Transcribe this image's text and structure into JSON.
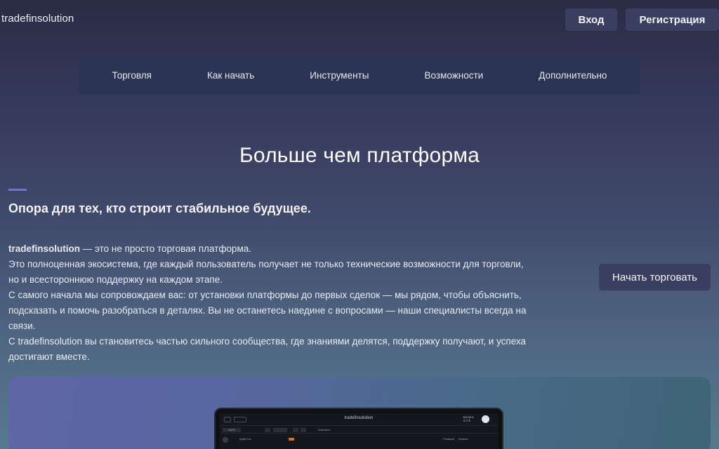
{
  "header": {
    "brand": "tradefinsolution",
    "login_label": "Вход",
    "register_label": "Регистрация"
  },
  "nav": {
    "items": [
      {
        "label": "Торговля"
      },
      {
        "label": "Как начать"
      },
      {
        "label": "Инструменты"
      },
      {
        "label": "Возможности"
      },
      {
        "label": "Дополнительно"
      }
    ]
  },
  "hero": {
    "title": "Больше чем платформа",
    "subtitle": "Опора для тех, кто строит стабильное будущее.",
    "lead_brand": "tradefinsolution",
    "lead_rest": " — это не просто торговая платформа.",
    "paragraph2": "Это полноценная экосистема, где каждый пользователь получает не только технические возможности для торговли, но и всестороннюю поддержку на каждом этапе.",
    "paragraph3": "С самого начала мы сопровождаем вас: от установки платформы до первых сделок — мы рядом, чтобы объяснить, подсказать и помочь разобраться в деталях. Вы не останетесь наедине с вопросами — наши специалисты всегда на связи.",
    "paragraph4": "С tradefinsolution вы становитесь частью сильного сообщества, где знаниями делятся, поддержку получают, и успеха достигают вместе.",
    "cta_label": "Начать торговать"
  },
  "showcase": {
    "screen_brand": "tradefinsolution",
    "balance_label": "Баланс",
    "balance_value": "0,0 $",
    "ticker": "AAPL",
    "asset_name": "Apple Inc",
    "indicators_label": "Indicators",
    "tab_positions": "Позиции",
    "tab_analysis": "Анализ",
    "accent_color": "#d4762a"
  },
  "colors": {
    "button_bg": "#3b3f5f",
    "nav_bg": "#2c3454",
    "accent_line": "#7d6fd1"
  }
}
